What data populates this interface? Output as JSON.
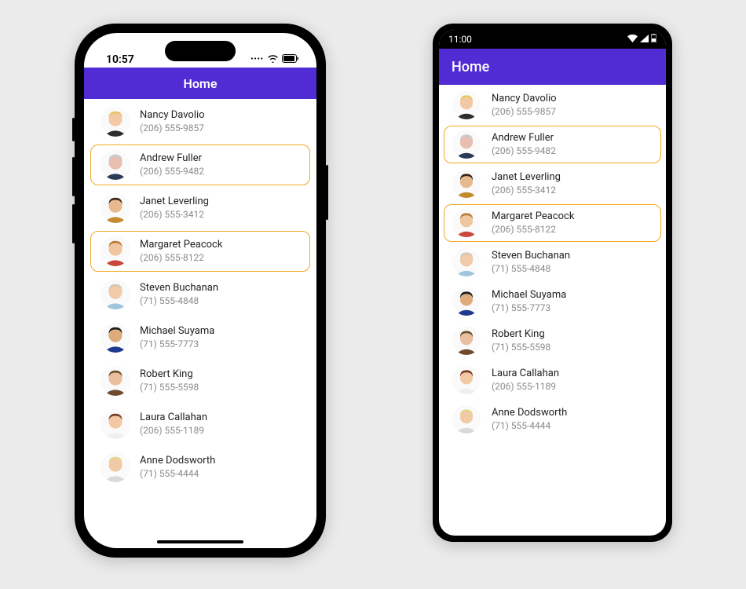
{
  "accent": "#512cd4",
  "highlight": "#f0a922",
  "ios": {
    "time": "10:57",
    "navbar_title": "Home"
  },
  "android": {
    "time": "11:00",
    "navbar_title": "Home"
  },
  "contacts": [
    {
      "name": "Nancy Davolio",
      "phone": "(206) 555-9857",
      "selected": false,
      "avatar": {
        "skin": "#f3c9a5",
        "hair": "#e8c56b",
        "top": "#2d2d2d"
      }
    },
    {
      "name": "Andrew Fuller",
      "phone": "(206) 555-9482",
      "selected": true,
      "avatar": {
        "skin": "#e8beb0",
        "hair": "#c9c9c9",
        "top": "#2b3a55"
      }
    },
    {
      "name": "Janet Leverling",
      "phone": "(206) 555-3412",
      "selected": false,
      "avatar": {
        "skin": "#e7b98f",
        "hair": "#3a2417",
        "top": "#c48a2e"
      }
    },
    {
      "name": "Margaret Peacock",
      "phone": "(206) 555-8122",
      "selected": true,
      "avatar": {
        "skin": "#f0c6a0",
        "hair": "#b97d3a",
        "top": "#c9473a"
      }
    },
    {
      "name": "Steven Buchanan",
      "phone": "(71) 555-4848",
      "selected": false,
      "avatar": {
        "skin": "#f1caa8",
        "hair": "#d3c7b5",
        "top": "#9fc6dd"
      }
    },
    {
      "name": "Michael Suyama",
      "phone": "(71) 555-7773",
      "selected": false,
      "avatar": {
        "skin": "#deac7a",
        "hair": "#1a1a1a",
        "top": "#1f3b8f"
      }
    },
    {
      "name": "Robert King",
      "phone": "(71) 555-5598",
      "selected": false,
      "avatar": {
        "skin": "#e9bfa0",
        "hair": "#6b5030",
        "top": "#6e4a2f"
      }
    },
    {
      "name": "Laura Callahan",
      "phone": "(206) 555-1189",
      "selected": false,
      "avatar": {
        "skin": "#f3c9a5",
        "hair": "#7a3a28",
        "top": "#efefef"
      }
    },
    {
      "name": "Anne Dodsworth",
      "phone": "(71) 555-4444",
      "selected": false,
      "avatar": {
        "skin": "#f1caa8",
        "hair": "#e4d68a",
        "top": "#d9d9d9"
      }
    }
  ]
}
